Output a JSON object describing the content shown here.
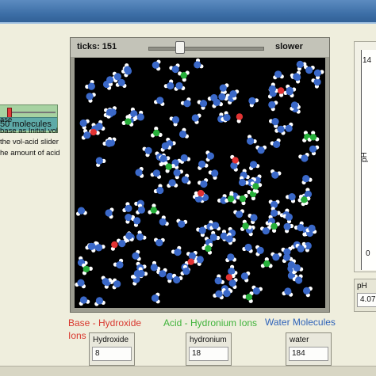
{
  "slider": {
    "value_label": "50 molecules",
    "fraction": 0.05
  },
  "instructions": [
    "ase",
    "base as Initial vol",
    "the vol-acid slider",
    "he amount of acid"
  ],
  "world": {
    "ticks_label": "ticks: 151",
    "speed_label": "slower",
    "speed_fraction": 0.27,
    "water_count": 184,
    "hydroxide_count": 8,
    "hydronium_count": 18,
    "colors": {
      "water": "#3a68c8",
      "hydrogen": "#ffffff",
      "hydroxide": "#e23333",
      "hydronium": "#27b03a"
    }
  },
  "ph_plot": {
    "y_max": "14",
    "y_min": "0",
    "axis_label": "pH"
  },
  "ph_monitor": {
    "label": "pH",
    "value": "4.07"
  },
  "legend": {
    "base": "Base - Hydroxide Ions",
    "acid": "Acid - Hydronium Ions",
    "water": "Water Molecules",
    "base_color": "#d9382f",
    "acid_color": "#3fb33a",
    "water_color": "#2f63b9"
  },
  "monitors": {
    "hydroxide": {
      "label": "Hydroxide",
      "value": "8"
    },
    "hydronium": {
      "label": "hydronium",
      "value": "18"
    },
    "water": {
      "label": "water",
      "value": "184"
    }
  }
}
